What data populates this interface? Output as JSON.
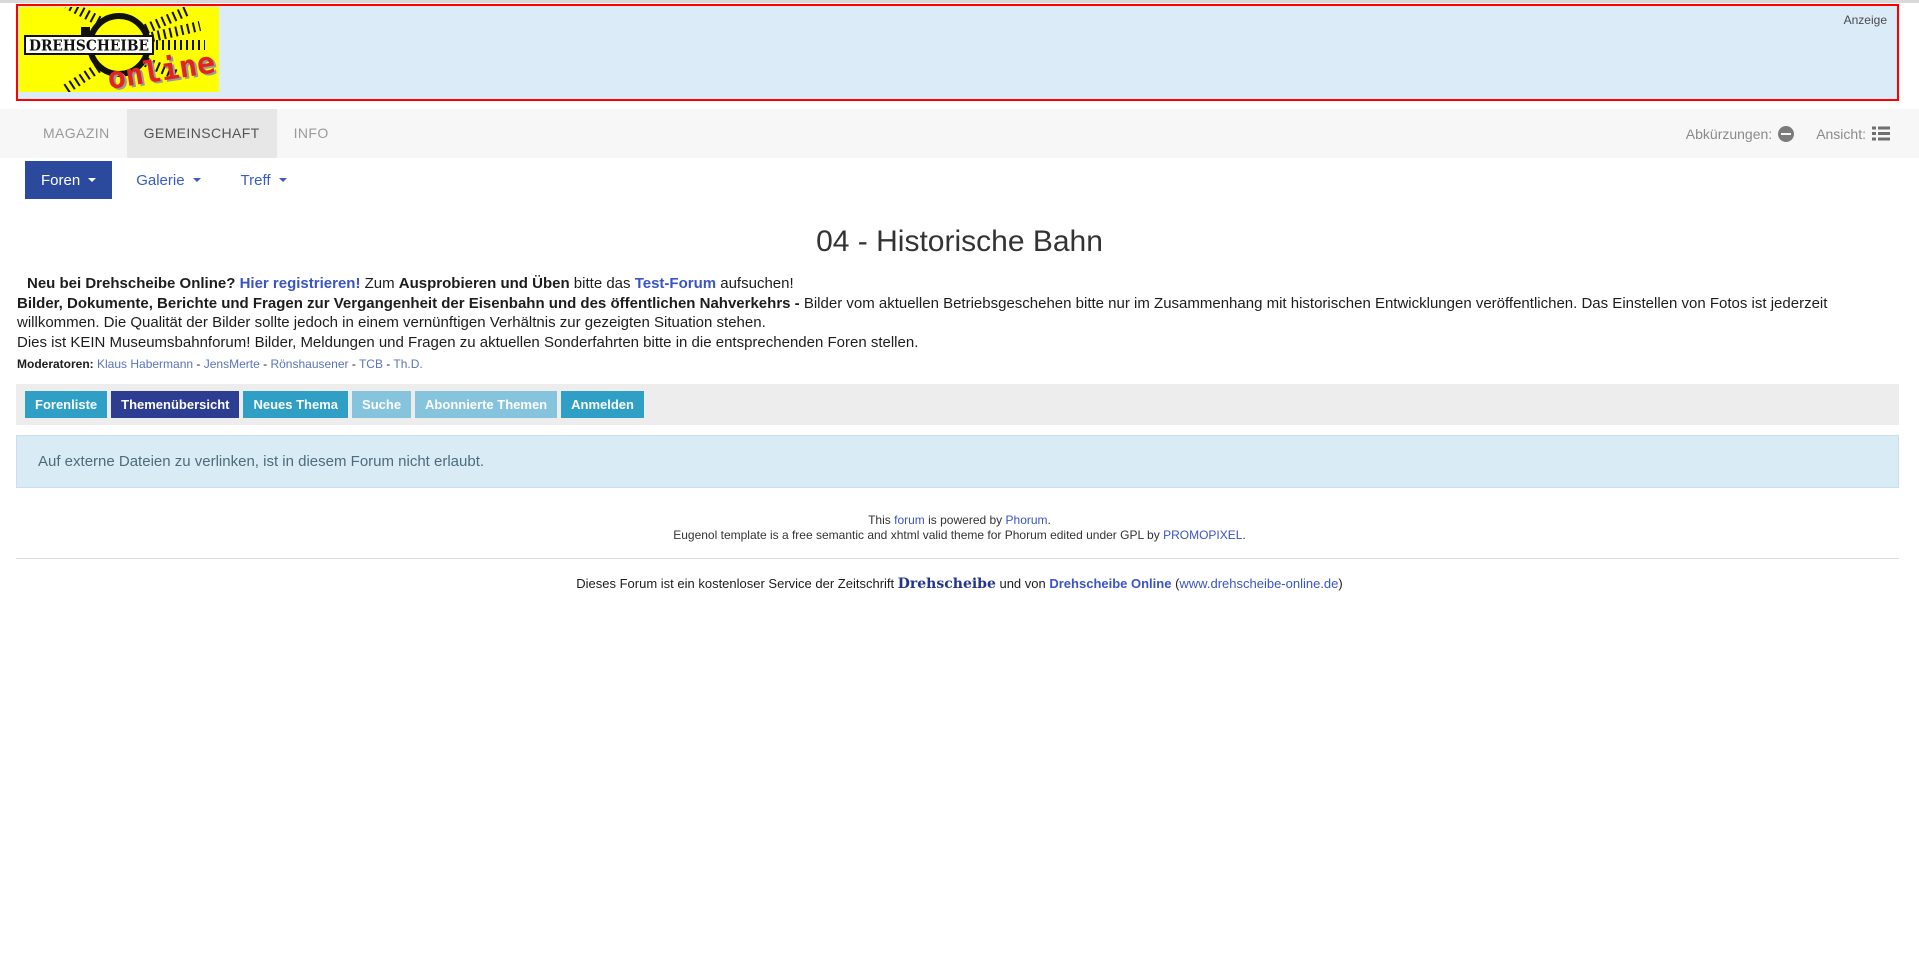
{
  "banner": {
    "ad_label": "Anzeige",
    "logo": {
      "title": "DREHSCHEIBE",
      "subtitle": "online"
    },
    "colors": {
      "background": "#dcebf8",
      "border": "#ff0000",
      "logo_background": "#ffff00",
      "logo_subtitle": "#e32222"
    }
  },
  "nav": {
    "tabs": [
      {
        "label": "MAGAZIN",
        "active": false
      },
      {
        "label": "GEMEINSCHAFT",
        "active": true
      },
      {
        "label": "INFO",
        "active": false
      }
    ],
    "right": [
      {
        "label": "Abkürzungen:",
        "icon": "minus-circle-icon"
      },
      {
        "label": "Ansicht:",
        "icon": "list-view-icon"
      }
    ]
  },
  "subnav": {
    "items": [
      {
        "label": "Foren",
        "style": "primary",
        "caret": true
      },
      {
        "label": "Galerie",
        "style": "link",
        "caret": true
      },
      {
        "label": "Treff",
        "style": "link",
        "caret": true
      }
    ],
    "colors": {
      "primary_background": "#2b4a9e",
      "link_text": "#3a5bc7"
    }
  },
  "page": {
    "title": "04 - Historische Bahn"
  },
  "description": {
    "line1": [
      {
        "t": "Neu bei Drehscheibe Online?",
        "bold": true
      },
      {
        "t": " "
      },
      {
        "t": "Hier registrieren!",
        "boldlink": true,
        "name": "register-link"
      },
      {
        "t": " Zum "
      },
      {
        "t": "Ausprobieren und Üben",
        "bold": true
      },
      {
        "t": " bitte das "
      },
      {
        "t": "Test-Forum",
        "boldlink": true,
        "name": "test-forum-link"
      },
      {
        "t": " aufsuchen!"
      }
    ],
    "para": [
      {
        "t": "Bilder, Dokumente, Berichte und Fragen zur Vergangenheit der Eisenbahn und des öffentlichen Nahverkehrs -",
        "bold": true
      },
      {
        "t": " Bilder vom aktuellen Betriebsgeschehen bitte nur im Zusammenhang mit historischen Entwicklungen veröffentlichen. Das Einstellen von Fotos ist jederzeit willkommen. Die Qualität der Bilder sollte jedoch in einem vernünftigen Verhältnis zur gezeigten Situation stehen."
      }
    ],
    "line4": "Dies ist KEIN Museumsbahnforum! Bilder, Meldungen und Fragen zu aktuellen Sonderfahrten bitte in die entsprechenden Foren stellen.",
    "moderators": {
      "label": "Moderatoren:",
      "separator": " - ",
      "names": [
        "Klaus Habermann",
        "JensMerte",
        "Rönshausener",
        "TCB",
        "Th.D."
      ]
    }
  },
  "toolbar": {
    "buttons": [
      {
        "label": "Forenliste",
        "variant": "teal"
      },
      {
        "label": "Themenübersicht",
        "variant": "navy"
      },
      {
        "label": "Neues Thema",
        "variant": "teal"
      },
      {
        "label": "Suche",
        "variant": "light"
      },
      {
        "label": "Abonnierte Themen",
        "variant": "light"
      },
      {
        "label": "Anmelden",
        "variant": "teal"
      }
    ],
    "colors": {
      "teal": "#2f9fc5",
      "navy": "#2c3d92",
      "light": "#86c3dc"
    }
  },
  "notice": {
    "text": "Auf externe Dateien zu verlinken, ist in diesem Forum nicht erlaubt.",
    "colors": {
      "background": "#d9ecf5",
      "text": "#4d6c7c"
    }
  },
  "footer": {
    "powered": [
      {
        "t": "This "
      },
      {
        "t": "forum",
        "link": true,
        "name": "forum-link"
      },
      {
        "t": " is powered by "
      },
      {
        "t": "Phorum",
        "link": true,
        "name": "phorum-link"
      },
      {
        "t": "."
      }
    ],
    "template_credit": [
      {
        "t": "Eugenol template is a free semantic and xhtml valid theme for Phorum edited under GPL by "
      },
      {
        "t": "PROMOPIXEL",
        "link": true,
        "name": "promopixel-link"
      },
      {
        "t": "."
      }
    ],
    "service_note": [
      {
        "t": "Dieses Forum ist ein kostenloser Service der Zeitschrift "
      },
      {
        "t": "Drehscheibe",
        "cls": "serif-brand",
        "name": "drehscheibe-magazine-brand"
      },
      {
        "t": " und von "
      },
      {
        "t": "Drehscheibe Online",
        "link": true,
        "cls": "bold-link",
        "name": "drehscheibe-online-link"
      },
      {
        "t": " ("
      },
      {
        "t": "www.drehscheibe-online.de",
        "link": true,
        "name": "drehscheibe-url-link"
      },
      {
        "t": ")"
      }
    ]
  }
}
